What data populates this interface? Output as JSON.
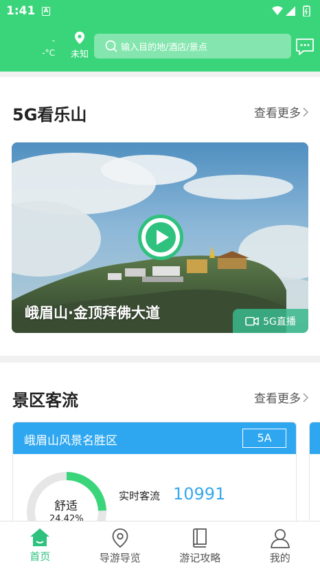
{
  "status_bar": {
    "time": "1:41",
    "notification_letter": "A"
  },
  "header": {
    "weather_top": "-",
    "weather_temp": "-°C",
    "location_label": "未知",
    "search_placeholder": "输入目的地/酒店/景点"
  },
  "section_5g": {
    "title": "5G看乐山",
    "more_label": "查看更多",
    "video": {
      "title": "峨眉山·金顶拜佛大道",
      "badge_label": "5G直播"
    }
  },
  "section_traffic": {
    "title": "景区客流",
    "more_label": "查看更多",
    "card": {
      "name": "峨眉山风景名胜区",
      "level": "5A",
      "comfort_label": "舒适",
      "comfort_percent": "24.42%",
      "comfort_fraction": 0.2442,
      "realtime_label": "实时客流",
      "realtime_value": "10991"
    }
  },
  "tabbar": {
    "tabs": [
      {
        "label": "首页",
        "icon": "home-icon",
        "active": true
      },
      {
        "label": "导游导览",
        "icon": "location-pin-icon",
        "active": false
      },
      {
        "label": "游记攻略",
        "icon": "book-icon",
        "active": false
      },
      {
        "label": "我的",
        "icon": "user-icon",
        "active": false
      }
    ]
  },
  "colors": {
    "brand_green": "#3ad57a",
    "accent_blue": "#2ea7f0",
    "active_tab": "#2ec27e"
  }
}
